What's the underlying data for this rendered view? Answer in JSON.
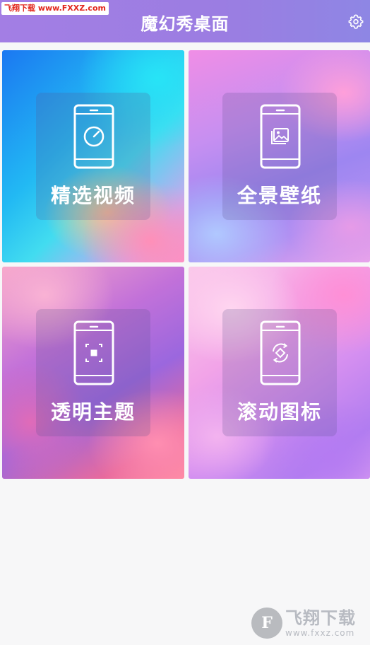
{
  "app": {
    "title": "魔幻秀桌面",
    "settings_icon": "gear-icon"
  },
  "watermark_top": {
    "text": "飞翔下载 www.FXXZ.com"
  },
  "cards": [
    {
      "label": "精选视频",
      "icon": "video-play-icon"
    },
    {
      "label": "全景壁纸",
      "icon": "image-gallery-icon"
    },
    {
      "label": "透明主题",
      "icon": "transparent-focus-icon"
    },
    {
      "label": "滚动图标",
      "icon": "rotate-icon"
    }
  ],
  "watermark_bottom": {
    "main": "飞翔下载",
    "url": "www.fxxz.com",
    "logo_letter": "F"
  }
}
